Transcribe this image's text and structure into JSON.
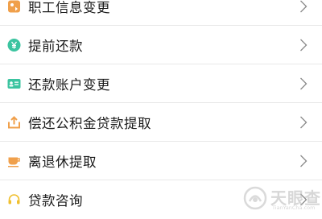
{
  "menu": {
    "items": [
      {
        "label": "职工信息变更",
        "icon": "people-swap-icon",
        "icon_color": "#f0a04b"
      },
      {
        "label": "提前还款",
        "icon": "yuan-circle-icon",
        "icon_color": "#3cc4a0"
      },
      {
        "label": "还款账户变更",
        "icon": "id-card-icon",
        "icon_color": "#3cc4a0"
      },
      {
        "label": "偿还公积金贷款提取",
        "icon": "export-tray-icon",
        "icon_color": "#f0a04b"
      },
      {
        "label": "离退休提取",
        "icon": "cup-icon",
        "icon_color": "#f0a04b"
      },
      {
        "label": "贷款咨询",
        "icon": "headset-icon",
        "icon_color": "#f0c030"
      }
    ]
  },
  "watermark": {
    "brand": "天眼查",
    "domain": "TianYanCha.com"
  }
}
